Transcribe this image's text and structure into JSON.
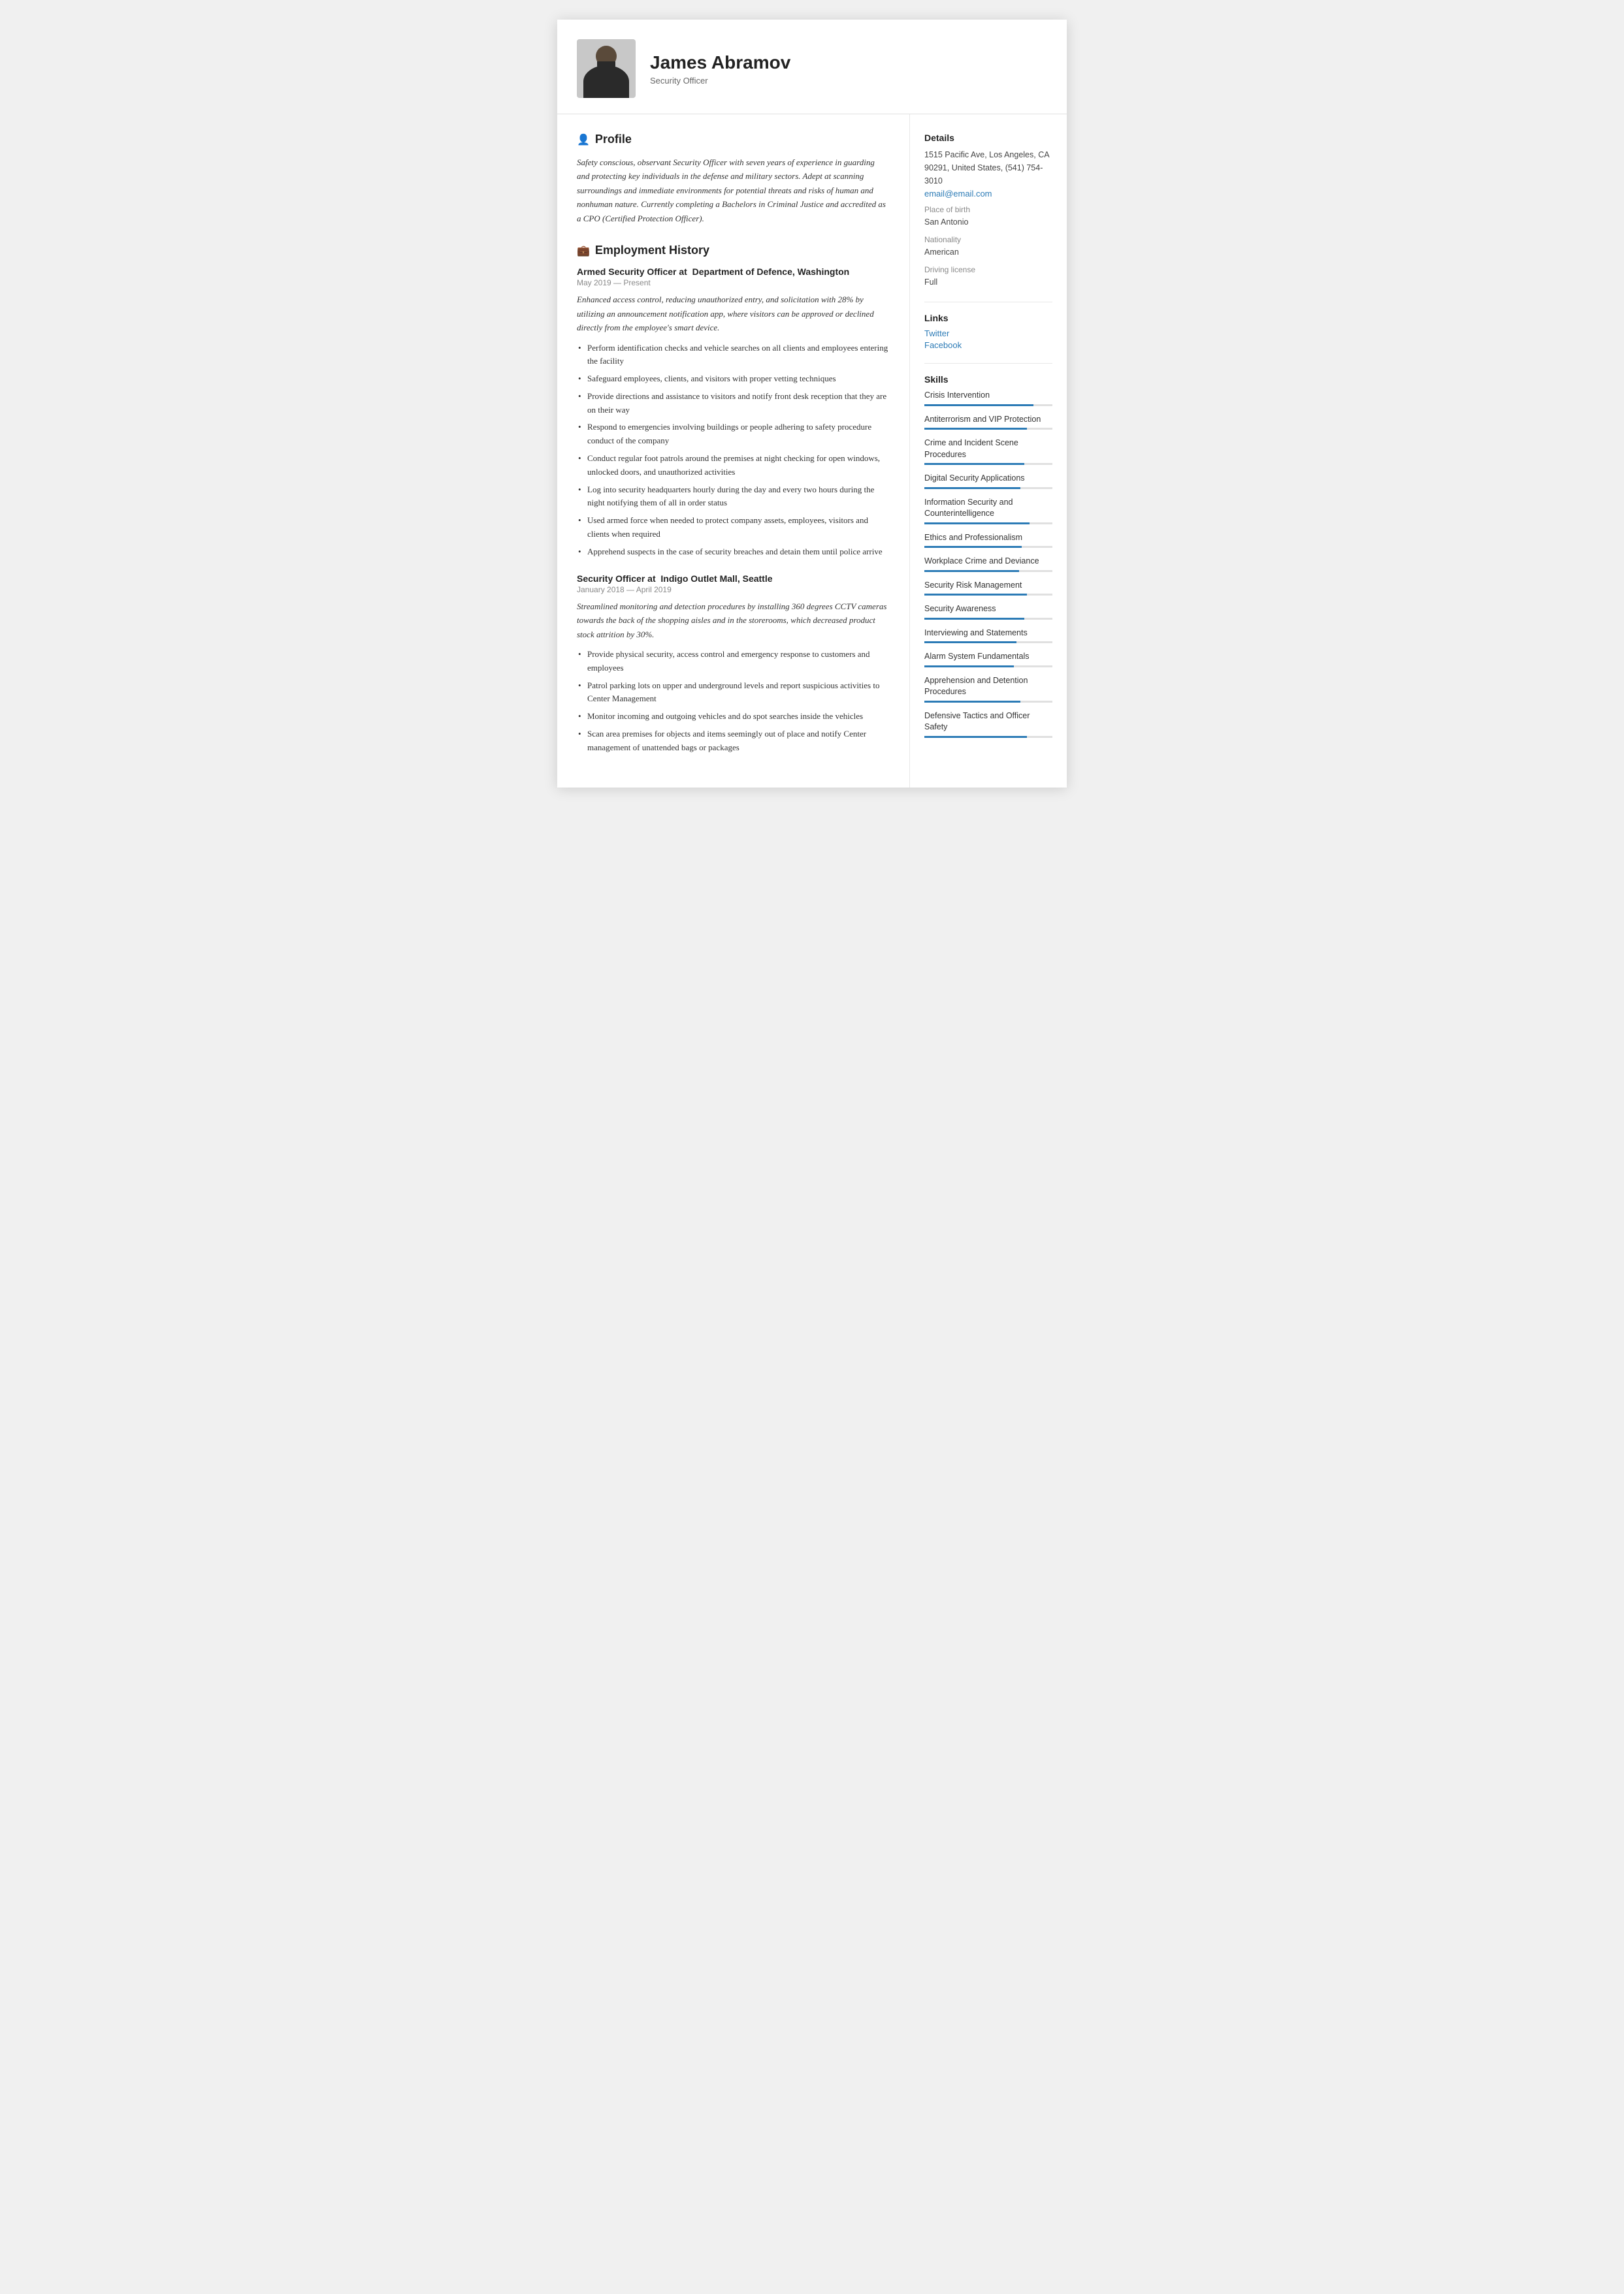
{
  "header": {
    "name": "James Abramov",
    "title": "Security Officer"
  },
  "profile": {
    "section_title": "Profile",
    "text": "Safety conscious, observant Security Officer with seven years of experience in guarding and protecting key individuals in the defense and military sectors. Adept at scanning surroundings and immediate environments for potential threats and risks of human and nonhuman nature. Currently completing a Bachelors in Criminal Justice and accredited as a CPO (Certified Protection Officer)."
  },
  "employment": {
    "section_title": "Employment History",
    "jobs": [
      {
        "title": "Armed Security Officer at",
        "company": "Department of Defence, Washington",
        "date": "May 2019 — Present",
        "description": "Enhanced access control, reducing unauthorized entry, and solicitation with 28% by utilizing an announcement notification app, where visitors can be approved or declined directly from the employee's smart device.",
        "bullets": [
          "Perform identification checks and vehicle searches on all clients and employees entering the facility",
          "Safeguard employees, clients, and visitors with proper vetting techniques",
          "Provide directions and assistance to visitors and notify front desk reception that they are on their way",
          "Respond to emergencies involving buildings or people adhering to safety procedure conduct of the company",
          "Conduct regular foot patrols around the premises at night checking for open windows, unlocked doors, and unauthorized activities",
          "Log into security headquarters hourly during the day and every two hours during the night notifying them of all in order status",
          "Used armed force when needed to protect company assets, employees, visitors and clients when required",
          "Apprehend suspects in the case of security breaches and detain them until police arrive"
        ]
      },
      {
        "title": "Security Officer at",
        "company": "Indigo Outlet Mall, Seattle",
        "date": "January 2018 — April 2019",
        "description": "Streamlined monitoring and detection procedures by installing 360 degrees CCTV cameras towards the back of the shopping aisles and in the storerooms, which decreased product stock attrition by 30%.",
        "bullets": [
          "Provide physical security, access control and emergency response to customers and employees",
          "Patrol parking lots on upper and underground levels and report suspicious activities to Center Management",
          "Monitor incoming and outgoing vehicles and do spot searches inside the vehicles",
          "Scan area premises for objects and items seemingly out of place and notify Center management of unattended bags or packages"
        ]
      }
    ]
  },
  "details": {
    "section_title": "Details",
    "address": "1515 Pacific Ave, Los Angeles, CA 90291, United States, (541) 754-3010",
    "email": "email@email.com",
    "place_of_birth_label": "Place of birth",
    "place_of_birth": "San Antonio",
    "nationality_label": "Nationality",
    "nationality": "American",
    "driving_license_label": "Driving license",
    "driving_license": "Full"
  },
  "links": {
    "section_title": "Links",
    "items": [
      {
        "label": "Twitter",
        "url": "#"
      },
      {
        "label": "Facebook",
        "url": "#"
      }
    ]
  },
  "skills": {
    "section_title": "Skills",
    "items": [
      {
        "name": "Crisis Intervention",
        "pct": 85
      },
      {
        "name": "Antiterrorism and VIP Protection",
        "pct": 80
      },
      {
        "name": "Crime and Incident Scene Procedures",
        "pct": 78
      },
      {
        "name": "Digital Security Applications",
        "pct": 75
      },
      {
        "name": "Information Security and Counterintelligence",
        "pct": 82
      },
      {
        "name": "Ethics and Professionalism",
        "pct": 76
      },
      {
        "name": "Workplace Crime and Deviance",
        "pct": 74
      },
      {
        "name": "Security Risk Management",
        "pct": 80
      },
      {
        "name": "Security Awareness",
        "pct": 78
      },
      {
        "name": "Interviewing and Statements",
        "pct": 72
      },
      {
        "name": "Alarm System Fundamentals",
        "pct": 70
      },
      {
        "name": "Apprehension and Detention Procedures",
        "pct": 75
      },
      {
        "name": "Defensive Tactics and Officer Safety",
        "pct": 80
      }
    ]
  }
}
